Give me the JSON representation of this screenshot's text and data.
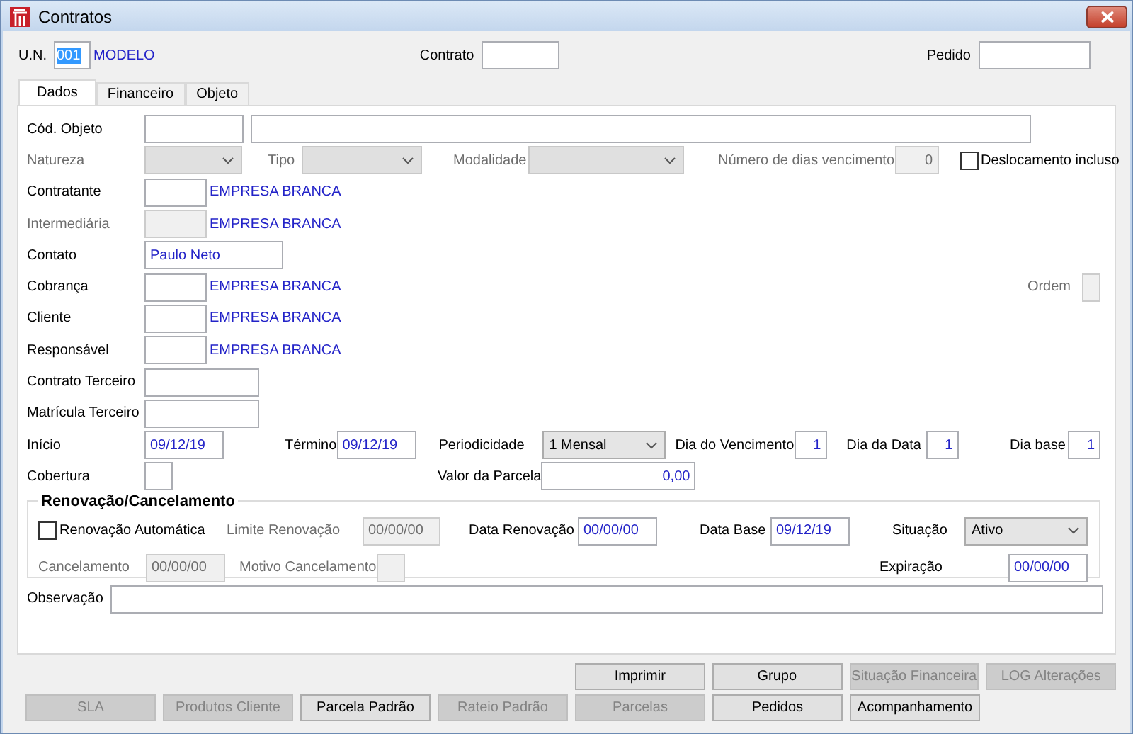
{
  "window": {
    "title": "Contratos"
  },
  "un": {
    "label": "U.N.",
    "code": "001",
    "code_selected": true,
    "name": "MODELO"
  },
  "contrato": {
    "label": "Contrato"
  },
  "pedido": {
    "label": "Pedido"
  },
  "tabs": [
    {
      "label": "Dados",
      "selected": true
    },
    {
      "label": "Financeiro",
      "selected": false
    },
    {
      "label": "Objeto",
      "selected": false
    }
  ],
  "cod_objeto": {
    "label": "Cód. Objeto"
  },
  "natureza": {
    "label": "Natureza",
    "disabled": true
  },
  "tipo": {
    "label": "Tipo",
    "disabled": true
  },
  "modalidade": {
    "label": "Modalidade",
    "disabled": true
  },
  "dias_vencimento": {
    "label": "Número de dias vencimento",
    "value": "0",
    "disabled": true
  },
  "deslocamento": {
    "label": "Deslocamento incluso",
    "checked": false
  },
  "people": [
    {
      "kind": "party",
      "label": "Contratante",
      "name": "EMPRESA BRANCA",
      "disabled": false
    },
    {
      "kind": "party",
      "label": "Intermediária",
      "name": "EMPRESA BRANCA",
      "disabled": true
    },
    {
      "kind": "text",
      "label": "Contato",
      "value": "Paulo Neto"
    },
    {
      "kind": "party",
      "label": "Cobrança",
      "name": "EMPRESA BRANCA",
      "disabled": false,
      "extra": {
        "label": "Ordem",
        "disabled": true
      }
    },
    {
      "kind": "party",
      "label": "Cliente",
      "name": "EMPRESA BRANCA",
      "disabled": false
    },
    {
      "kind": "party",
      "label": "Responsável",
      "name": "EMPRESA BRANCA",
      "disabled": false
    },
    {
      "kind": "text",
      "label": "Contrato Terceiro"
    },
    {
      "kind": "text",
      "label": "Matrícula Terceiro"
    }
  ],
  "inicio": {
    "label": "Início",
    "value": "09/12/19"
  },
  "termino": {
    "label": "Término",
    "value": "09/12/19"
  },
  "periodicidade": {
    "label": "Periodicidade",
    "value": "1 Mensal"
  },
  "dia_vencimento": {
    "label": "Dia do Vencimento",
    "value": "1"
  },
  "dia_data": {
    "label": "Dia da Data",
    "value": "1"
  },
  "dia_base": {
    "label": "Dia base",
    "value": "1"
  },
  "cobertura": {
    "label": "Cobertura"
  },
  "valor_parcela": {
    "label": "Valor da Parcela",
    "value": "0,00"
  },
  "renovacao": {
    "title": "Renovação/Cancelamento",
    "automatica": {
      "label": "Renovação Automática",
      "checked": false
    },
    "limite": {
      "label": "Limite Renovação",
      "value": "00/00/00",
      "disabled": true
    },
    "data_renovacao": {
      "label": "Data Renovação",
      "value": "00/00/00"
    },
    "data_base": {
      "label": "Data Base",
      "value": "09/12/19"
    },
    "situacao": {
      "label": "Situação",
      "value": "Ativo"
    },
    "cancelamento": {
      "label": "Cancelamento",
      "value": "00/00/00",
      "disabled": true
    },
    "motivo": {
      "label": "Motivo Cancelamento",
      "disabled": true
    },
    "expiracao": {
      "label": "Expiração",
      "value": "00/00/00"
    }
  },
  "observacao": {
    "label": "Observação"
  },
  "button_rows": [
    [
      {
        "label": "Imprimir",
        "disabled": false
      },
      {
        "label": "Grupo",
        "disabled": false
      },
      {
        "label": "Situação Financeira",
        "disabled": true
      },
      {
        "label": "LOG Alterações",
        "disabled": true
      }
    ],
    [
      {
        "label": "SLA",
        "disabled": true
      },
      {
        "label": "Produtos Cliente",
        "disabled": true
      },
      {
        "label": "Parcela Padrão",
        "disabled": false
      },
      {
        "label": "Rateio Padrão",
        "disabled": true
      },
      {
        "label": "Parcelas",
        "disabled": true
      },
      {
        "label": "Pedidos",
        "disabled": false
      },
      {
        "label": "Acompanhamento",
        "disabled": false
      }
    ]
  ]
}
